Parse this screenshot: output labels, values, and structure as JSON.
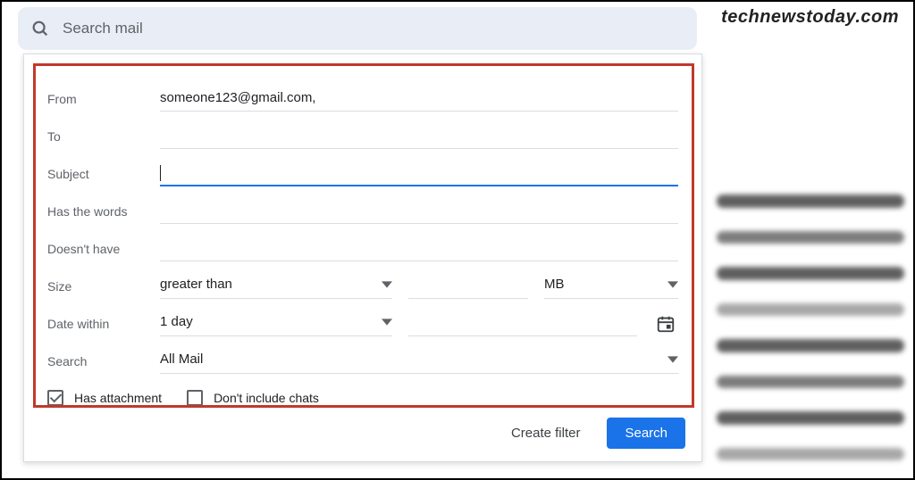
{
  "watermark": "technewstoday.com",
  "search": {
    "placeholder": "Search mail"
  },
  "form": {
    "from": {
      "label": "From",
      "value": "someone123@gmail.com,"
    },
    "to": {
      "label": "To",
      "value": ""
    },
    "subject": {
      "label": "Subject",
      "value": ""
    },
    "hasWords": {
      "label": "Has the words",
      "value": ""
    },
    "doesntHave": {
      "label": "Doesn't have",
      "value": ""
    },
    "size": {
      "label": "Size",
      "comparator": "greater than",
      "value": "",
      "unit": "MB"
    },
    "dateWithin": {
      "label": "Date within",
      "range": "1 day",
      "date": ""
    },
    "searchIn": {
      "label": "Search",
      "value": "All Mail"
    },
    "hasAttachment": {
      "label": "Has attachment",
      "checked": true
    },
    "dontIncludeChats": {
      "label": "Don't include chats",
      "checked": false
    }
  },
  "actions": {
    "createFilter": "Create filter",
    "search": "Search"
  }
}
